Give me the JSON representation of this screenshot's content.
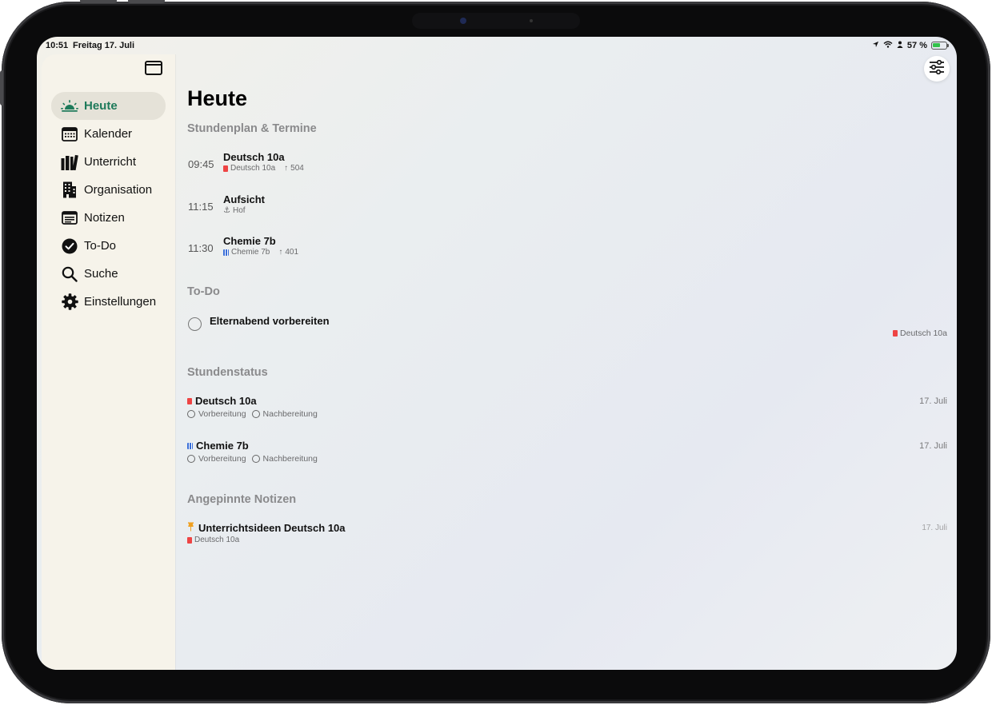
{
  "status_bar": {
    "time": "10:51",
    "date": "Freitag 17. Juli",
    "battery": "57 %",
    "icons": [
      "location-arrow-icon",
      "wifi-icon",
      "person-icon",
      "battery-charging-icon"
    ]
  },
  "sidebar": {
    "toggle_icon": "sidebar-toggle-icon",
    "items": [
      {
        "label": "Heute",
        "icon": "sunrise-icon",
        "active": true
      },
      {
        "label": "Kalender",
        "icon": "calendar-icon",
        "active": false
      },
      {
        "label": "Unterricht",
        "icon": "books-icon",
        "active": false
      },
      {
        "label": "Organisation",
        "icon": "building-icon",
        "active": false
      },
      {
        "label": "Notizen",
        "icon": "notes-icon",
        "active": false
      },
      {
        "label": "To-Do",
        "icon": "checkmark-circle-icon",
        "active": false
      },
      {
        "label": "Suche",
        "icon": "search-icon",
        "active": false
      },
      {
        "label": "Einstellungen",
        "icon": "gear-icon",
        "active": false
      }
    ]
  },
  "header": {
    "title": "Heute",
    "filter_icon": "sliders-icon"
  },
  "schedule": {
    "title": "Stundenplan & Termine",
    "items": [
      {
        "time": "09:45",
        "title": "Deutsch 10a",
        "class": "Deutsch 10a",
        "room": "504",
        "color": "#e44444"
      },
      {
        "time": "11:15",
        "title": "Aufsicht",
        "class": "Hof",
        "room": "",
        "color": "#777777"
      },
      {
        "time": "11:30",
        "title": "Chemie 7b",
        "class": "Chemie 7b",
        "room": "401",
        "color": "#3a6fd8"
      }
    ]
  },
  "todo": {
    "title": "To-Do",
    "items": [
      {
        "text": "Elternabend vorbereiten",
        "tag": "Deutsch 10a"
      }
    ]
  },
  "lesson_status": {
    "title": "Stundenstatus",
    "prep_label": "Vorbereitung",
    "post_label": "Nachbereitung",
    "items": [
      {
        "title": "Deutsch 10a",
        "date": "17. Juli"
      },
      {
        "title": "Chemie 7b",
        "date": "17. Juli"
      }
    ]
  },
  "pinned_notes": {
    "title": "Angepinnte Notizen",
    "items": [
      {
        "title": "Unterrichtsideen Deutsch 10a",
        "tag": "Deutsch 10a",
        "date": "17. Juli"
      }
    ]
  },
  "colors": {
    "accent": "#1e7a5a",
    "german": "#e44444",
    "chemistry": "#3a6fd8",
    "pin": "#f0a020"
  }
}
